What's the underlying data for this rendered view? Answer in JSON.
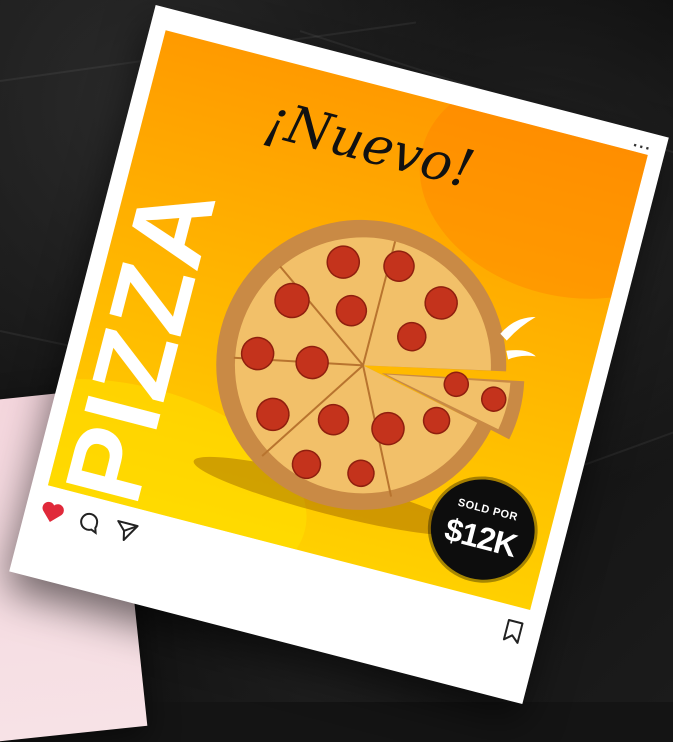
{
  "post": {
    "vertical_title": "PIZZA",
    "script_title": "¡Nuevo!",
    "price": {
      "prefix": "SOLD POR",
      "amount": "$12K"
    },
    "more_label": "···"
  },
  "actions": {
    "like_icon": "heart-icon",
    "comment_icon": "comment-icon",
    "share_icon": "send-icon",
    "save_icon": "bookmark-icon"
  },
  "colors": {
    "background": "#141414",
    "accent_orange": "#ff9a00",
    "accent_yellow": "#ffd000",
    "like_red": "#e0293a",
    "card_pink": "#f4d6dd"
  }
}
